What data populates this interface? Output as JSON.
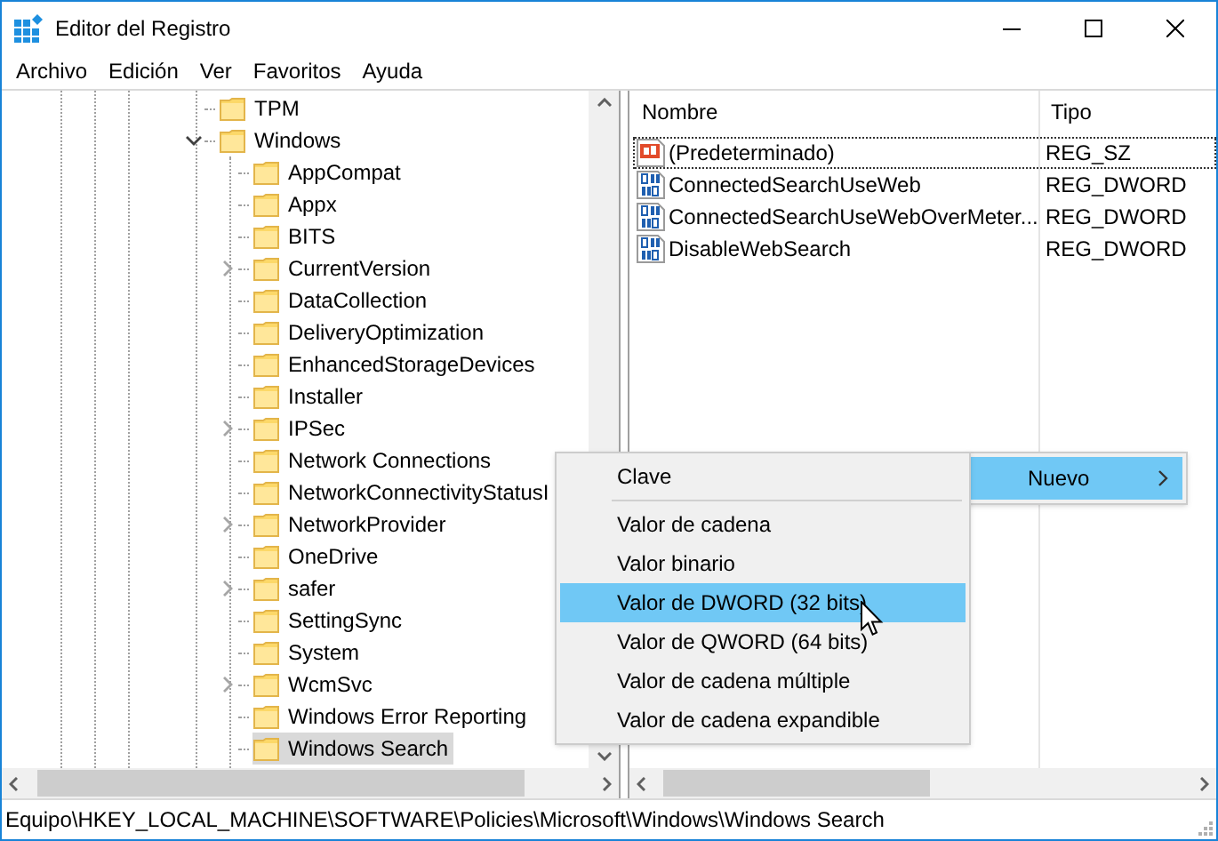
{
  "window": {
    "title": "Editor del Registro"
  },
  "menu_bar": [
    "Archivo",
    "Edición",
    "Ver",
    "Favoritos",
    "Ayuda"
  ],
  "tree": [
    {
      "label": "TPM",
      "selected": false
    },
    {
      "label": "Windows",
      "expanded": true,
      "selected": false,
      "children": [
        {
          "label": "AppCompat",
          "selected": false
        },
        {
          "label": "Appx",
          "selected": false
        },
        {
          "label": "BITS",
          "selected": false
        },
        {
          "label": "CurrentVersion",
          "expanded": false,
          "selected": false
        },
        {
          "label": "DataCollection",
          "selected": false
        },
        {
          "label": "DeliveryOptimization",
          "selected": false
        },
        {
          "label": "EnhancedStorageDevices",
          "selected": false
        },
        {
          "label": "Installer",
          "selected": false
        },
        {
          "label": "IPSec",
          "expanded": false,
          "selected": false
        },
        {
          "label": "Network Connections",
          "selected": false
        },
        {
          "label": "NetworkConnectivityStatusI",
          "selected": false
        },
        {
          "label": "NetworkProvider",
          "expanded": false,
          "selected": false
        },
        {
          "label": "OneDrive",
          "selected": false
        },
        {
          "label": "safer",
          "expanded": false,
          "selected": false
        },
        {
          "label": "SettingSync",
          "selected": false
        },
        {
          "label": "System",
          "selected": false
        },
        {
          "label": "WcmSvc",
          "expanded": false,
          "selected": false
        },
        {
          "label": "Windows Error Reporting",
          "selected": false
        },
        {
          "label": "Windows Search",
          "selected": true
        }
      ]
    }
  ],
  "values_list": {
    "columns": [
      "Nombre",
      "Tipo"
    ],
    "rows": [
      {
        "name": "(Predeterminado)",
        "type": "REG_SZ",
        "kind": "string",
        "focused": true
      },
      {
        "name": "ConnectedSearchUseWeb",
        "type": "REG_DWORD",
        "kind": "dword",
        "focused": false
      },
      {
        "name": "ConnectedSearchUseWebOverMeter...",
        "type": "REG_DWORD",
        "kind": "dword",
        "focused": false
      },
      {
        "name": "DisableWebSearch",
        "type": "REG_DWORD",
        "kind": "dword",
        "focused": false
      }
    ]
  },
  "context_menu": {
    "items": [
      {
        "label": "Nuevo",
        "selected": true,
        "submenu": true
      }
    ]
  },
  "submenu": {
    "items": [
      {
        "kind": "item",
        "label": "Clave",
        "selected": false
      },
      {
        "kind": "separator"
      },
      {
        "kind": "item",
        "label": "Valor de cadena",
        "selected": false
      },
      {
        "kind": "item",
        "label": "Valor binario",
        "selected": false
      },
      {
        "kind": "item",
        "label": "Valor de DWORD (32 bits)",
        "selected": true
      },
      {
        "kind": "item",
        "label": "Valor de QWORD (64 bits)",
        "selected": false
      },
      {
        "kind": "item",
        "label": "Valor de cadena múltiple",
        "selected": false
      },
      {
        "kind": "item",
        "label": "Valor de cadena expandible",
        "selected": false
      }
    ]
  },
  "status_bar": "Equipo\\HKEY_LOCAL_MACHINE\\SOFTWARE\\Policies\\Microsoft\\Windows\\Windows Search"
}
